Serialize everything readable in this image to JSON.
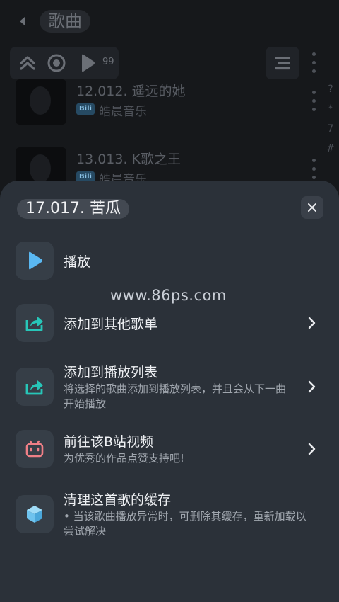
{
  "header": {
    "title": "歌曲"
  },
  "toolbar": {
    "count": "99"
  },
  "index_letters": [
    "?",
    "*",
    "7",
    "#"
  ],
  "songs": [
    {
      "title": "12.012. 遥远的她",
      "badge": "Bili",
      "artist": "皓晨音乐"
    },
    {
      "title": "13.013. K歌之王",
      "badge": "Bili",
      "artist": "皓晨音乐"
    }
  ],
  "sheet": {
    "title": "17.017. 苦瓜",
    "watermark": "www.86ps.com",
    "items": [
      {
        "label": "播放",
        "icon": "play-icon",
        "color": "#5ab8f2"
      },
      {
        "label": "添加到其他歌单",
        "icon": "share-icon",
        "color": "#27c6b8"
      },
      {
        "label": "添加到播放列表",
        "desc": "将选择的歌曲添加到播放列表，并且会从下一曲开始播放",
        "icon": "share-icon",
        "color": "#27c6b8"
      },
      {
        "label": "前往该B站视频",
        "desc": "为优秀的作品点赞支持吧!",
        "icon": "bilibili-icon",
        "color": "#ef7f86"
      },
      {
        "label": "清理这首歌的缓存",
        "desc": "• 当该歌曲播放异常时，可删除其缓存，重新加载以尝试解决",
        "icon": "cube-icon",
        "color": "#6ec3ee"
      }
    ]
  }
}
